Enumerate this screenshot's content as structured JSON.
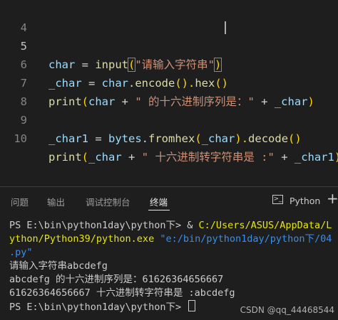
{
  "editor": {
    "line_numbers": [
      "4",
      "5",
      "6",
      "7",
      "8",
      "9",
      "10"
    ],
    "l5": {
      "a": "char",
      "b": " = ",
      "c": "input",
      "d": "(",
      "e": "\"请输入字符串\"",
      "g": ")"
    },
    "l6": {
      "a": "_char",
      "b": " = ",
      "c": "char",
      "d": ".",
      "e": "encode",
      "f": "().",
      "g": "hex",
      "h": "()"
    },
    "l7": {
      "a": "print",
      "b": "(",
      "c": "char",
      "d": " + ",
      "e": "\" 的十六进制序列是：\"",
      "f": " + ",
      "g": "_char",
      "h": ")"
    },
    "l9": {
      "a": "_char1",
      "b": " = ",
      "c": "bytes",
      "d": ".",
      "e": "fromhex",
      "f": "(",
      "g": "_char",
      "h": ").",
      "i": "decode",
      "j": "()"
    },
    "l10": {
      "a": "print",
      "b": "(",
      "c": "_char",
      "d": " + ",
      "e": "\" 十六进制转字符串是 :\"",
      "f": " + ",
      "g": "_char1",
      "h": ")"
    }
  },
  "panel": {
    "tabs": [
      "问题",
      "输出",
      "调试控制台",
      "终端"
    ],
    "active_tab": "终端",
    "terminal_icon": "terminal-icon",
    "terminal_name": "Python",
    "add_icon": "+"
  },
  "terminal": {
    "l1_prompt": "PS E:\\bin\\python1day\\python下> ",
    "l1_amp": "& ",
    "l1_cmd": "C:/Users/ASUS/AppData/L",
    "l2_cmd": "ython/Python39/python.exe",
    "l2_path": " \"e:/bin/python1day/python下/04",
    "l3_path": ".py\"",
    "l4": "请输入字符串abcdefg",
    "l5": "abcdefg 的十六进制序列是：61626364656667",
    "l6": "61626364656667 十六进制转字符串是 :abcdefg",
    "l7_prompt": "PS E:\\bin\\python1day\\python下> "
  },
  "watermark": "CSDN @qq_44468544"
}
